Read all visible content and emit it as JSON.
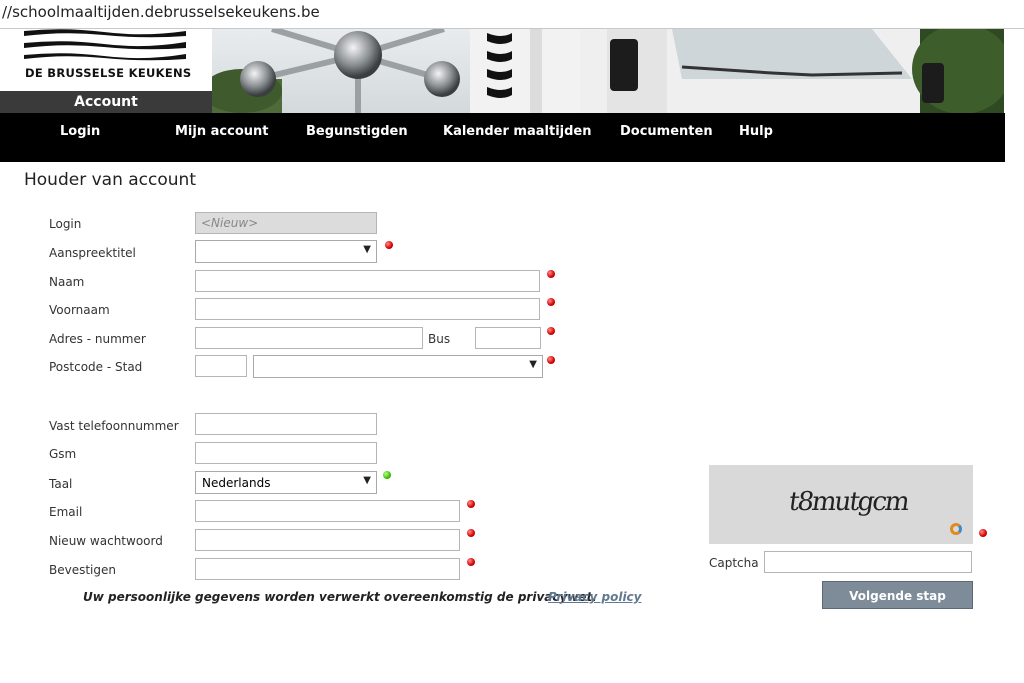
{
  "browser": {
    "url": "//schoolmaaltijden.debrusselsekeukens.be"
  },
  "header": {
    "logo_text": "DE BRUSSELSE KEUKENS",
    "account_tab": "Account"
  },
  "nav": {
    "items": [
      {
        "label": "Login"
      },
      {
        "label": "Mijn account"
      },
      {
        "label": "Begunstigden"
      },
      {
        "label": "Kalender maaltijden"
      },
      {
        "label": "Documenten"
      },
      {
        "label": "Hulp"
      }
    ]
  },
  "form": {
    "title": "Houder van account",
    "login": {
      "label": "Login",
      "value": "<Nieuw>"
    },
    "aanspreektitel": {
      "label": "Aanspreektitel",
      "value": ""
    },
    "naam": {
      "label": "Naam",
      "value": ""
    },
    "voornaam": {
      "label": "Voornaam",
      "value": ""
    },
    "adres": {
      "label": "Adres - nummer",
      "bus_label": "Bus",
      "value": "",
      "bus_value": ""
    },
    "postcode": {
      "label": "Postcode - Stad",
      "value": "",
      "stad_value": ""
    },
    "vast_tel": {
      "label": "Vast telefoonnummer",
      "value": ""
    },
    "gsm": {
      "label": "Gsm",
      "value": ""
    },
    "taal": {
      "label": "Taal",
      "value": "Nederlands"
    },
    "email": {
      "label": "Email",
      "value": ""
    },
    "wachtwoord": {
      "label": "Nieuw wachtwoord",
      "value": ""
    },
    "bevestigen": {
      "label": "Bevestigen",
      "value": ""
    },
    "privacy_text": "Uw persoonlijke gegevens worden verwerkt overeenkomstig de privacywet.",
    "privacy_link": "Privacy policy"
  },
  "captcha": {
    "image_text": "t8mutgcm",
    "label": "Captcha",
    "value": "",
    "submit_label": "Volgende stap"
  },
  "colors": {
    "required_dot": "#d40000",
    "ok_dot": "#3cbf00",
    "nav_bg": "#000000",
    "button_bg": "#7d8c98"
  }
}
